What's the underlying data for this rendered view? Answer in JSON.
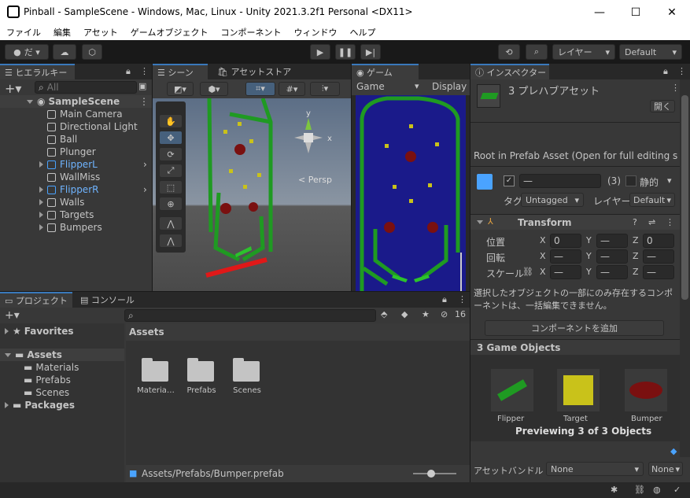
{
  "window": {
    "title": "Pinball - SampleScene - Windows, Mac, Linux - Unity 2021.3.2f1 Personal <DX11>",
    "minimize": "—",
    "maximize": "☐",
    "close": "✕"
  },
  "menu": [
    "ファイル",
    "編集",
    "アセット",
    "ゲームオブジェクト",
    "コンポーネント",
    "ウィンドウ",
    "ヘルプ"
  ],
  "toolbar": {
    "account": "だ ▾",
    "layers": "レイヤー",
    "layout": "Default"
  },
  "hierarchy": {
    "tab": "ヒエラルキー",
    "search_placeholder": "All",
    "scene": "SampleScene",
    "items": [
      {
        "label": "Main Camera",
        "blue": false
      },
      {
        "label": "Directional Light",
        "blue": false
      },
      {
        "label": "Ball",
        "blue": false
      },
      {
        "label": "Plunger",
        "blue": false
      },
      {
        "label": "FlipperL",
        "blue": true
      },
      {
        "label": "WallMiss",
        "blue": false
      },
      {
        "label": "FlipperR",
        "blue": true
      },
      {
        "label": "Walls",
        "blue": false
      },
      {
        "label": "Targets",
        "blue": false
      },
      {
        "label": "Bumpers",
        "blue": false
      }
    ]
  },
  "scene_view": {
    "tab_scene": "シーン",
    "tab_store": "アセットストア",
    "persp": "Persp",
    "axis_y": "y",
    "axis_x": "x"
  },
  "game_view": {
    "tab": "ゲーム",
    "display_mode": "Game",
    "display": "Display"
  },
  "inspector": {
    "tab": "インスペクター",
    "header": "3 プレハブアセット",
    "open": "開く",
    "root_note": "Root in Prefab Asset (Open for full editing su",
    "count": "(3)",
    "static": "静的",
    "tag_label": "タグ",
    "tag_value": "Untagged",
    "layer_label": "レイヤー",
    "layer_value": "Default",
    "transform": "Transform",
    "position_label": "位置",
    "rotation_label": "回転",
    "scale_label": "スケール",
    "pos": {
      "x": "0",
      "y": "—",
      "z": "0"
    },
    "rot": {
      "x": "—",
      "y": "—",
      "z": "—"
    },
    "scl": {
      "x": "—",
      "y": "—",
      "z": "—"
    },
    "note": "選択したオブジェクトの一部にのみ存在するコンポーネントは、一括編集できません。",
    "add_component": "コンポーネントを追加",
    "preview_title": "3 Game Objects",
    "previews": [
      {
        "label": "Flipper",
        "color": "#1f9a22"
      },
      {
        "label": "Target",
        "color": "#c9c21a"
      },
      {
        "label": "Bumper",
        "color": "#7a1010"
      }
    ],
    "previewing": "Previewing 3 of 3 Objects",
    "asset_bundle_label": "アセットバンドル",
    "bundle": "None",
    "variant": "None"
  },
  "project": {
    "tab_project": "プロジェクト",
    "tab_console": "コンソール",
    "hidden_count": "16",
    "favorites": "Favorites",
    "assets": "Assets",
    "asset_children": [
      "Materials",
      "Prefabs",
      "Scenes"
    ],
    "packages": "Packages",
    "grid_title": "Assets",
    "folders": [
      "Materia…",
      "Prefabs",
      "Scenes"
    ],
    "path": "Assets/Prefabs/Bumper.prefab"
  }
}
